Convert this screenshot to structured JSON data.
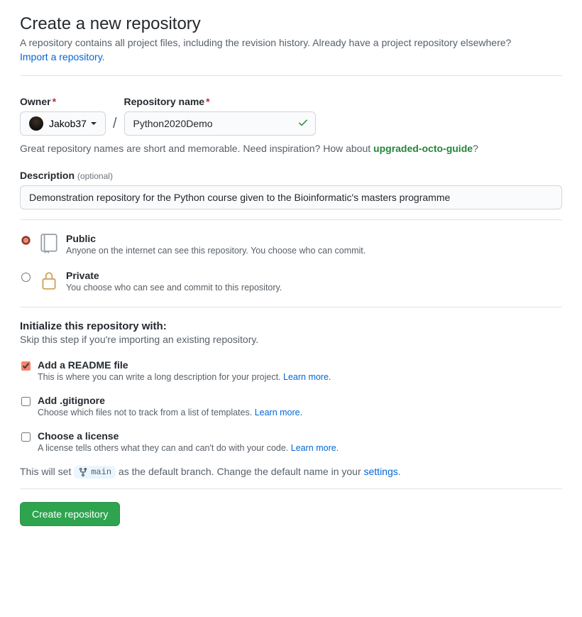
{
  "header": {
    "title": "Create a new repository",
    "subtitle": "A repository contains all project files, including the revision history. Already have a project repository elsewhere?",
    "import_link": "Import a repository."
  },
  "owner": {
    "label": "Owner",
    "name": "Jakob37"
  },
  "repo": {
    "label": "Repository name",
    "value": "Python2020Demo"
  },
  "name_hint": {
    "prefix": "Great repository names are short and memorable. Need inspiration? How about ",
    "suggestion": "upgraded-octo-guide",
    "suffix": "?"
  },
  "description": {
    "label": "Description",
    "optional": "(optional)",
    "value": "Demonstration repository for the Python course given to the Bioinformatic's masters programme"
  },
  "visibility": {
    "public": {
      "title": "Public",
      "desc": "Anyone on the internet can see this repository. You choose who can commit."
    },
    "private": {
      "title": "Private",
      "desc": "You choose who can see and commit to this repository."
    }
  },
  "init": {
    "title": "Initialize this repository with:",
    "subtitle": "Skip this step if you're importing an existing repository.",
    "readme": {
      "title": "Add a README file",
      "desc": "This is where you can write a long description for your project. ",
      "learn": "Learn more."
    },
    "gitignore": {
      "title": "Add .gitignore",
      "desc": "Choose which files not to track from a list of templates. ",
      "learn": "Learn more."
    },
    "license": {
      "title": "Choose a license",
      "desc": "A license tells others what they can and can't do with your code. ",
      "learn": "Learn more."
    }
  },
  "branch": {
    "prefix": "This will set ",
    "name": "main",
    "mid": " as the default branch. Change the default name in your ",
    "link": "settings",
    "suffix": "."
  },
  "submit": {
    "label": "Create repository"
  }
}
